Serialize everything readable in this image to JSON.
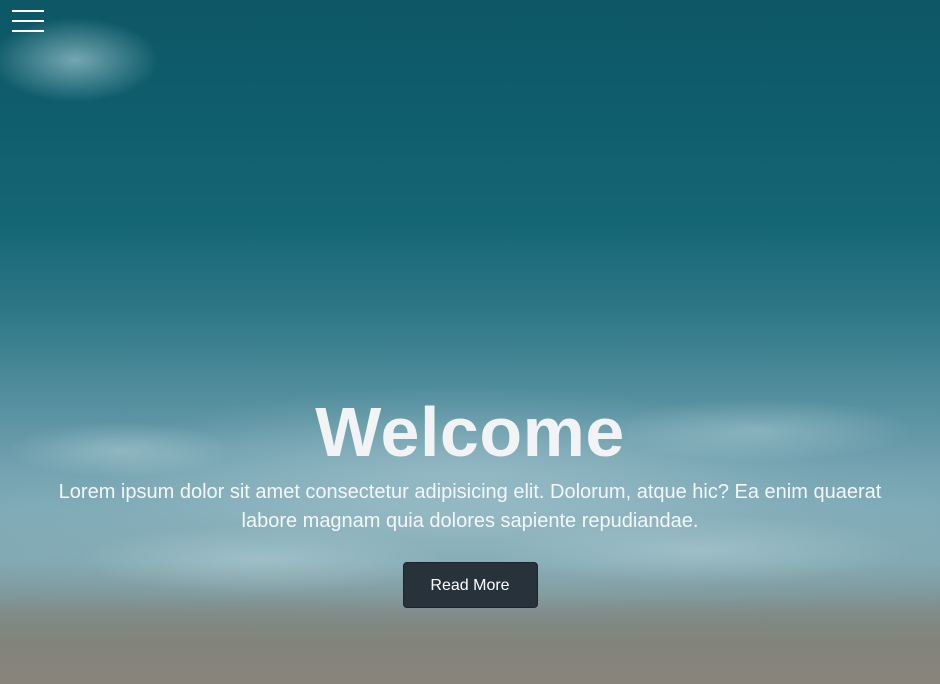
{
  "hero": {
    "title": "Welcome",
    "subtitle": "Lorem ipsum dolor sit amet consectetur adipisicing elit. Dolorum, atque hic? Ea enim quaerat labore magnam quia dolores sapiente repudiandae.",
    "cta_label": "Read More"
  },
  "nav": {
    "menu_icon": "hamburger-menu-icon"
  },
  "colors": {
    "button_bg": "#27323a",
    "text": "#f1f3f4",
    "ocean_deep": "#0d5766",
    "ocean_shallow": "#7aa7b4"
  }
}
